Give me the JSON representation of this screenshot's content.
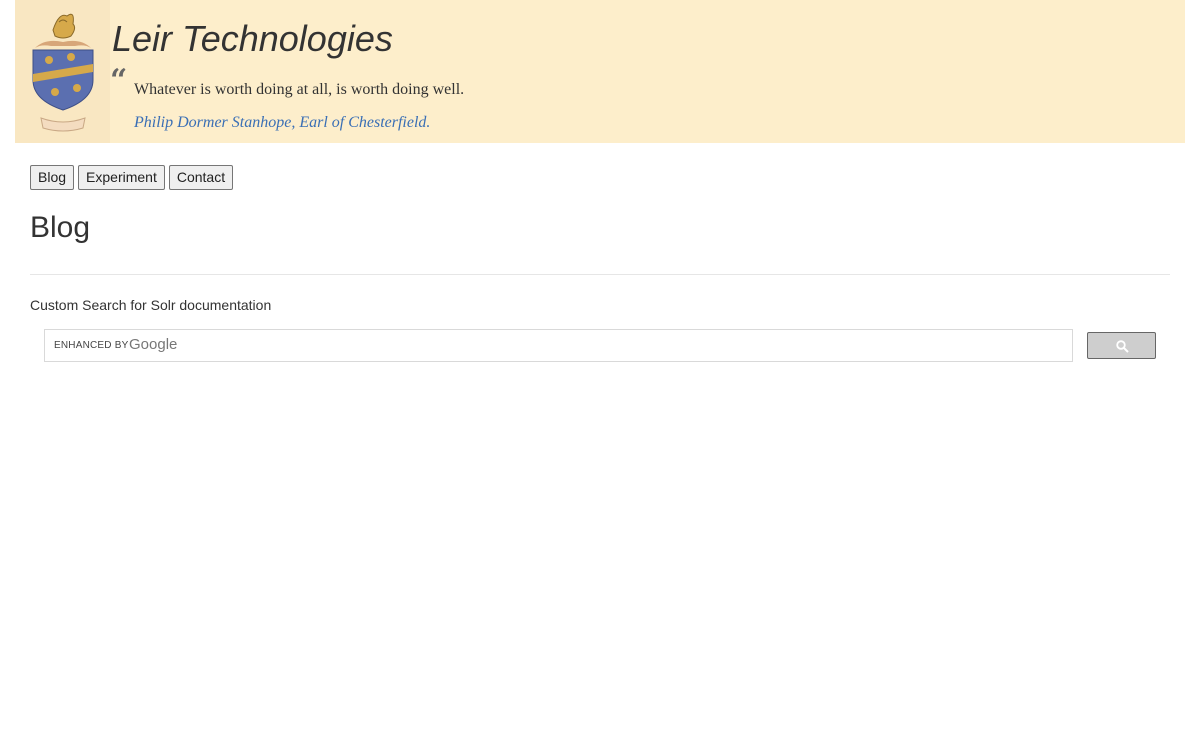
{
  "header": {
    "site_title": "Leir Technologies",
    "quote_mark": "“",
    "quote_text": "Whatever is worth doing at all, is worth doing well.",
    "quote_author": "Philip Dormer Stanhope, Earl of Chesterfield."
  },
  "nav": {
    "items": [
      {
        "label": "Blog"
      },
      {
        "label": "Experiment"
      },
      {
        "label": "Contact"
      }
    ]
  },
  "main": {
    "heading": "Blog",
    "search_caption": "Custom Search for Solr documentation",
    "search": {
      "enhanced_label": "ENHANCED BY",
      "google_label": "Google",
      "value": "",
      "button_icon": "search-icon"
    }
  },
  "colors": {
    "header_bg": "#fdeecb",
    "author_link": "#3a6fb5",
    "crest_shield": "#5b6fb0",
    "crest_gold": "#d6a94a"
  }
}
